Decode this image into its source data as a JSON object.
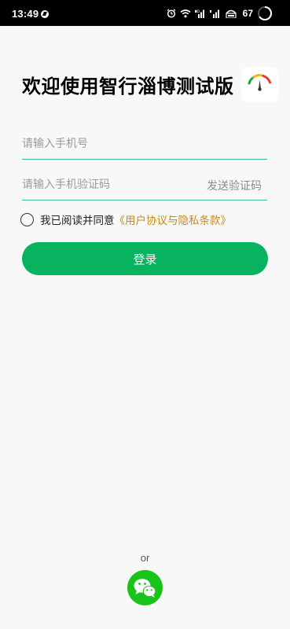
{
  "status_bar": {
    "time": "13:49",
    "battery": "67"
  },
  "header": {
    "title": "欢迎使用智行淄博测试版"
  },
  "form": {
    "phone_placeholder": "请输入手机号",
    "code_placeholder": "请输入手机验证码",
    "send_code_label": "发送验证码",
    "agree_text": "我已阅读并同意",
    "agree_link": "《用户协议与隐私条款》",
    "login_label": "登录"
  },
  "footer": {
    "or_text": "or"
  },
  "icons": {
    "status": [
      "notification-icon",
      "alarm-icon",
      "wifi-icon",
      "signal-icon",
      "signal-icon",
      "hotspot-icon",
      "battery-icon"
    ],
    "logo": "speedometer-logo",
    "login_alt": "wechat-icon"
  },
  "colors": {
    "accent_green": "#07b35f",
    "input_underline": "#3fc28a",
    "link_gold": "#c88a17",
    "wechat_green": "#1ac31a"
  }
}
